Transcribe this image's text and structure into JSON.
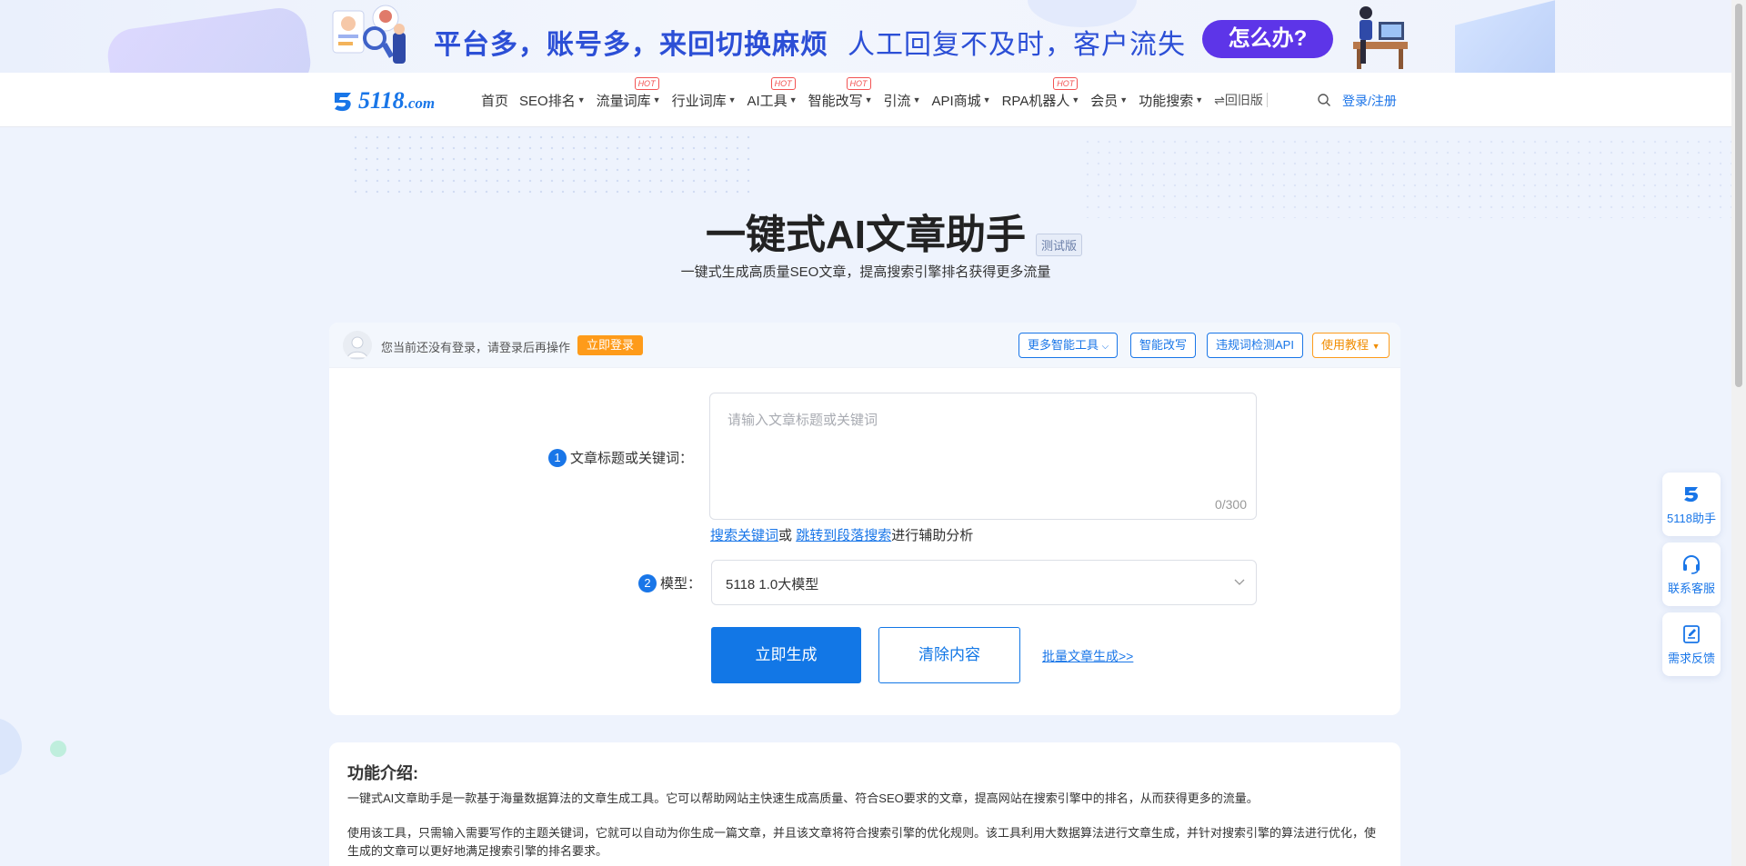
{
  "banner": {
    "slogan_primary": "平台多，账号多，来回切换麻烦",
    "slogan_secondary": "人工回复不及时，客户流失",
    "cta": "怎么办?"
  },
  "nav": {
    "logo_main": "5118",
    "logo_suffix": ".com",
    "items": [
      {
        "label": "首页",
        "dropdown": false,
        "hot": ""
      },
      {
        "label": "SEO排名",
        "dropdown": true,
        "hot": ""
      },
      {
        "label": "流量词库",
        "dropdown": true,
        "hot": "HOT"
      },
      {
        "label": "行业词库",
        "dropdown": true,
        "hot": ""
      },
      {
        "label": "AI工具",
        "dropdown": true,
        "hot": "HOT"
      },
      {
        "label": "智能改写",
        "dropdown": true,
        "hot": "HOT"
      },
      {
        "label": "引流",
        "dropdown": true,
        "hot": ""
      },
      {
        "label": "API商城",
        "dropdown": true,
        "hot": ""
      },
      {
        "label": "RPA机器人",
        "dropdown": true,
        "hot": "HOT"
      },
      {
        "label": "会员",
        "dropdown": true,
        "hot": ""
      },
      {
        "label": "功能搜索",
        "dropdown": true,
        "hot": ""
      }
    ],
    "old_version": "⇌回旧版",
    "login": "登录/注册"
  },
  "hero": {
    "title": "一键式AI文章助手",
    "badge": "测试版",
    "subtitle": "一键式生成高质量SEO文章，提高搜索引擎排名获得更多流量"
  },
  "card": {
    "login_hint": "您当前还没有登录，请登录后再操作",
    "login_button": "立即登录",
    "tools": {
      "more_tools": "更多智能工具",
      "rewrite": "智能改写",
      "violation_api": "违规词检测API",
      "tutorial": "使用教程"
    },
    "step1": {
      "number": "1",
      "label": "文章标题或关键词：",
      "placeholder": "请输入文章标题或关键词",
      "value": "",
      "counter": "0/300"
    },
    "aux": {
      "link1": "搜索关键词",
      "or": "或",
      "link2": "跳转到段落搜索",
      "suffix": "进行辅助分析"
    },
    "step2": {
      "number": "2",
      "label": "模型：",
      "selected": "5118 1.0大模型"
    },
    "generate": "立即生成",
    "clear": "清除内容",
    "batch": "批量文章生成>>"
  },
  "intro": {
    "title": "功能介绍:",
    "para1": "一键式AI文章助手是一款基于海量数据算法的文章生成工具。它可以帮助网站主快速生成高质量、符合SEO要求的文章，提高网站在搜索引擎中的排名，从而获得更多的流量。",
    "para2": "使用该工具，只需输入需要写作的主题关键词，它就可以自动为你生成一篇文章，并且该文章将符合搜索引擎的优化规则。该工具利用大数据算法进行文章生成，并针对搜索引擎的算法进行优化，使生成的文章可以更好地满足搜索引擎的排名要求。"
  },
  "side_tools": [
    {
      "label": "5118助手",
      "icon": "logo-icon"
    },
    {
      "label": "联系客服",
      "icon": "headset-icon"
    },
    {
      "label": "需求反馈",
      "icon": "feedback-icon"
    }
  ],
  "colors": {
    "primary": "#1277e6",
    "accent_orange": "#fe9b1a",
    "banner_purple": "#5d35e8",
    "hot_red": "#f25353"
  }
}
